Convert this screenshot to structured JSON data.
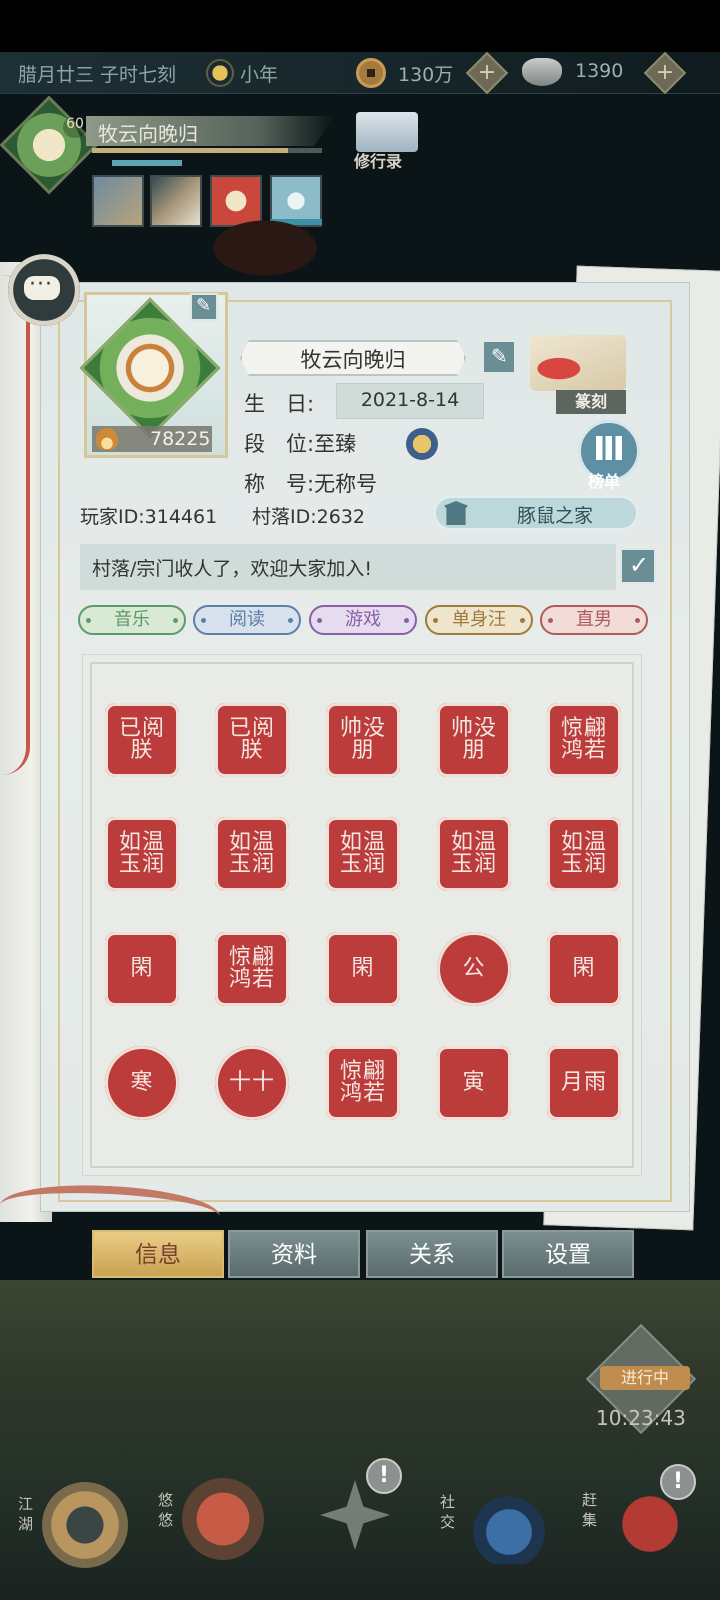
{
  "header": {
    "date": "腊月廿三 子时七刻",
    "season": "小年",
    "copper": "130万",
    "silver": "1390",
    "plus": "+",
    "level": "60",
    "player_name": "牧云向晚归",
    "xiuxing_label": "修行录"
  },
  "profile": {
    "name": "牧云向晚归",
    "power": "78225",
    "birthday_label": "生　日:",
    "birthday": "2021-8-14",
    "rank_label": "段　位:",
    "rank": "至臻",
    "title_label": "称　号:",
    "title": "无称号",
    "player_id_label": "玩家ID:",
    "player_id": "314461",
    "village_id_label": "村落ID:",
    "village_id": "2632",
    "family": "豚鼠之家",
    "signature": "村落/宗门收人了，欢迎大家加入!",
    "seal_button": "篆刻",
    "rank_button": "榜单"
  },
  "tags": [
    {
      "label": "音乐",
      "color": "#5b9a6a",
      "bg": "#d8ead4"
    },
    {
      "label": "阅读",
      "color": "#5d7fa6",
      "bg": "#d7e2ee"
    },
    {
      "label": "游戏",
      "color": "#8a5fa8",
      "bg": "#e6dcef"
    },
    {
      "label": "单身汪",
      "color": "#a07a3a",
      "bg": "#efe4cc"
    },
    {
      "label": "直男",
      "color": "#b25a5a",
      "bg": "#f1dcd8"
    }
  ],
  "seals": [
    [
      "已阅朕",
      "已阅朕",
      "帅没朋",
      "帅没朋",
      "惊翩鸿若"
    ],
    [
      "如温玉润",
      "如温玉润",
      "如温玉润",
      "如温玉润",
      "如温玉润"
    ],
    [
      "閑",
      "惊翩鸿若",
      "閑",
      "公",
      "閑"
    ],
    [
      "寒",
      "十十",
      "惊翩鸿若",
      "寅",
      "月雨"
    ]
  ],
  "tabs": {
    "info": "信息",
    "data": "资料",
    "relations": "关系",
    "settings": "设置"
  },
  "status": {
    "progress": "进行中",
    "clock": "10:23:43"
  },
  "nav": {
    "jianghu": "江湖",
    "youyou": "悠悠",
    "shejiao": "社交",
    "ganji": "赶集",
    "alert": "!"
  }
}
